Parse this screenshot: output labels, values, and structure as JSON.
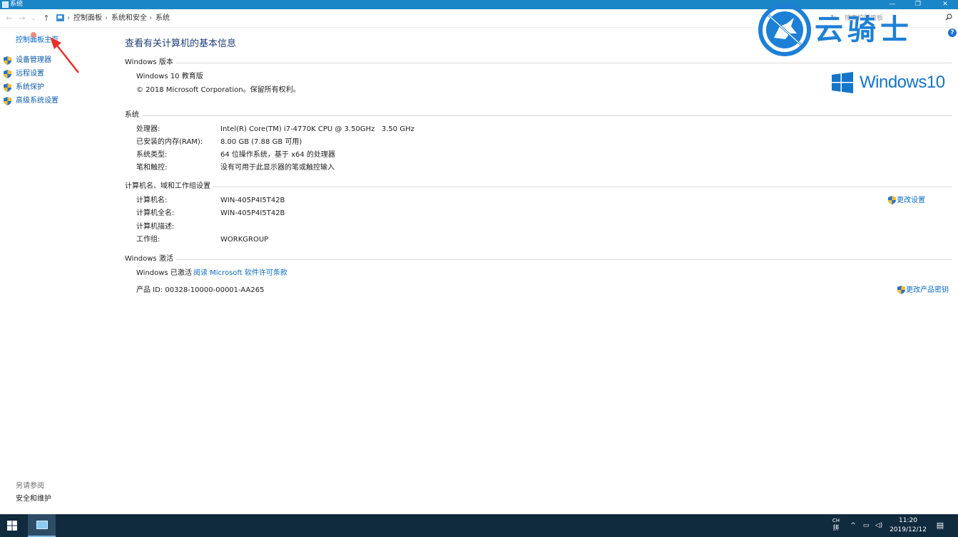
{
  "window": {
    "title": "系统",
    "controls": {
      "minimize": "—",
      "restore": "❐",
      "close": "✕"
    }
  },
  "addressbar": {
    "back": "←",
    "forward": "→",
    "recent": "⌄",
    "up": "↑",
    "breadcrumbs": [
      "控制面板",
      "系统和安全",
      "系统"
    ],
    "separator": "›",
    "dropdown": "⌄",
    "refresh": "↻",
    "search_placeholder": "搜索控制面板"
  },
  "left_pane": {
    "home_link": "控制面板主页",
    "links": [
      "设备管理器",
      "远程设置",
      "系统保护",
      "高级系统设置"
    ],
    "see_also_title": "另请参阅",
    "see_also_link": "安全和维护"
  },
  "main": {
    "page_title": "查看有关计算机的基本信息",
    "edition": {
      "title": "Windows 版本",
      "name": "Windows 10 教育版",
      "copyright": "© 2018 Microsoft Corporation。保留所有权利。",
      "logo_text": "Windows10"
    },
    "system": {
      "title": "系统",
      "rows": [
        {
          "label": "处理器:",
          "value": "Intel(R) Core(TM) i7-4770K CPU @ 3.50GHz   3.50 GHz"
        },
        {
          "label": "已安装的内存(RAM):",
          "value": "8.00 GB (7.88 GB 可用)"
        },
        {
          "label": "系统类型:",
          "value": "64 位操作系统，基于 x64 的处理器"
        },
        {
          "label": "笔和触控:",
          "value": "没有可用于此显示器的笔或触控输入"
        }
      ]
    },
    "computer": {
      "title": "计算机名、域和工作组设置",
      "rows": [
        {
          "label": "计算机名:",
          "value": "WIN-405P4I5T42B"
        },
        {
          "label": "计算机全名:",
          "value": "WIN-405P4I5T42B"
        },
        {
          "label": "计算机描述:",
          "value": ""
        },
        {
          "label": "工作组:",
          "value": "WORKGROUP"
        }
      ],
      "change_settings": "更改设置"
    },
    "activation": {
      "title": "Windows 激活",
      "status": "Windows 已激活",
      "license_link": "阅读 Microsoft 软件许可条款",
      "product_id": "产品 ID: 00328-10000-00001-AA265",
      "change_key": "更改产品密钥"
    }
  },
  "watermark": {
    "text": "云骑士"
  },
  "help": "?",
  "taskbar": {
    "lang_top": "CH",
    "lang_bottom": "拼",
    "tray_chevron": "^",
    "network": "▭",
    "volume": "◁)",
    "time": "11:20",
    "date": "2019/12/12",
    "notification": "▤"
  },
  "colors": {
    "titlebar": "#1b86c7",
    "link": "#0b6cc4",
    "taskbar": "#102a3e",
    "win10_blue": "#1475c9",
    "annotation_red": "#e8302a"
  }
}
